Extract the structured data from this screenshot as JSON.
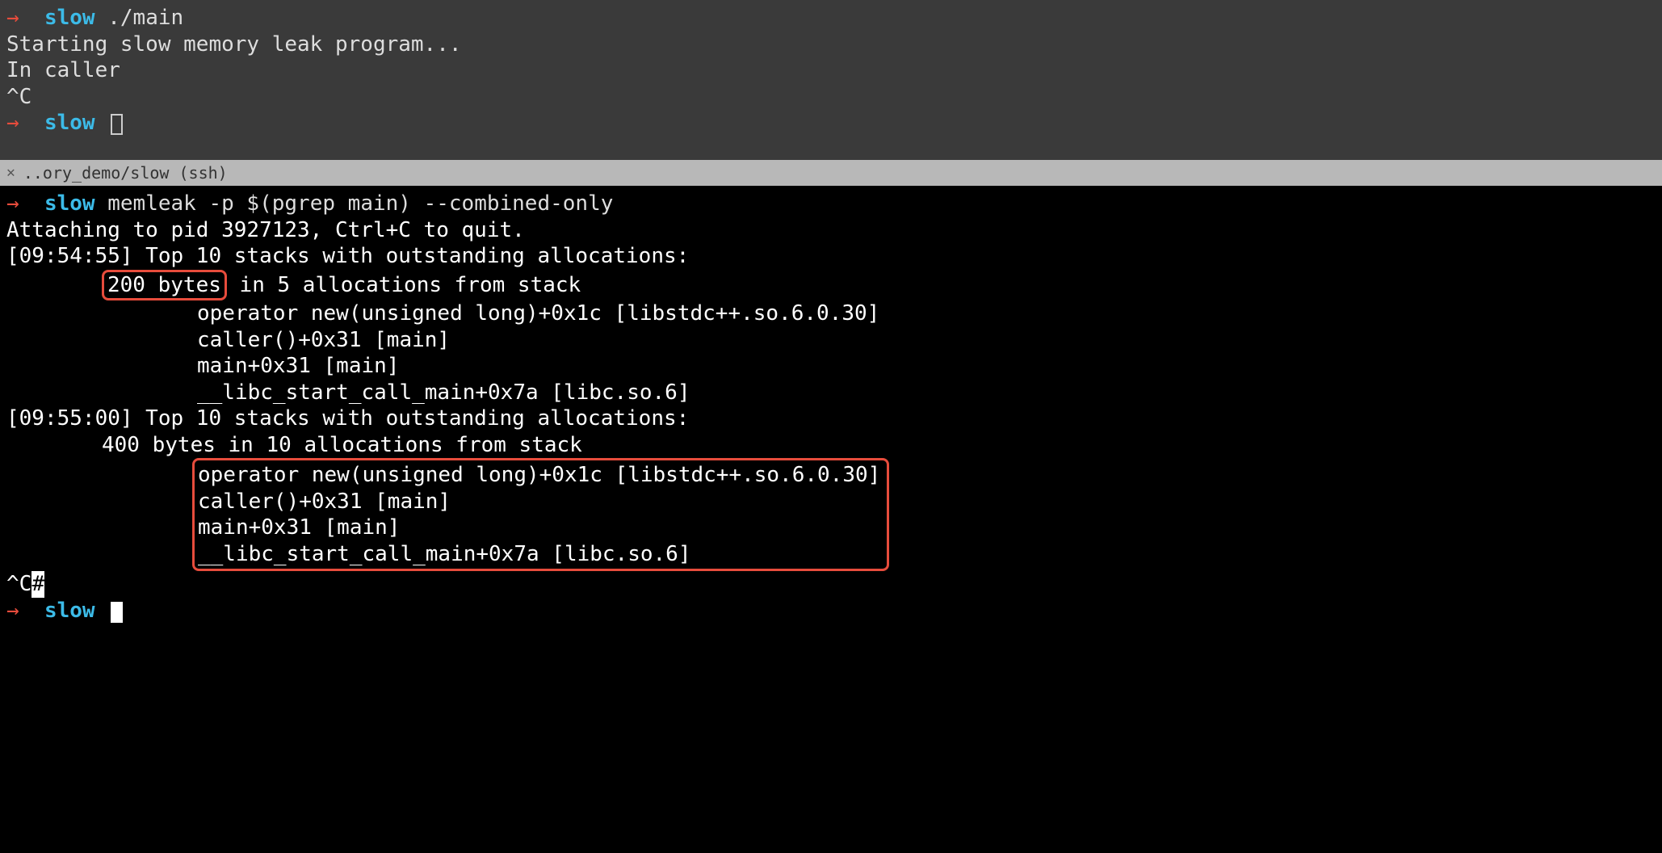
{
  "top": {
    "prompt1_arrow": "→",
    "prompt1_ctx": "slow",
    "prompt1_cmd": "./main",
    "out1": "Starting slow memory leak program...",
    "out2": "In caller",
    "out3": "^C",
    "prompt2_arrow": "→",
    "prompt2_ctx": "slow"
  },
  "tab": {
    "close": "✕",
    "title": "..ory_demo/slow (ssh)"
  },
  "bottom": {
    "prompt1_arrow": "→",
    "prompt1_ctx": "slow",
    "prompt1_cmd": "memleak -p $(pgrep main) --combined-only",
    "line1": "Attaching to pid 3927123, Ctrl+C to quit.",
    "line2": "[09:54:55] Top 10 stacks with outstanding allocations:",
    "hl1": "200 bytes",
    "line3_rest": " in 5 allocations from stack",
    "stack1_1": "operator new(unsigned long)+0x1c [libstdc++.so.6.0.30]",
    "stack1_2": "caller()+0x31 [main]",
    "stack1_3": "main+0x31 [main]",
    "stack1_4": "__libc_start_call_main+0x7a [libc.so.6]",
    "line4": "[09:55:00] Top 10 stacks with outstanding allocations:",
    "line5": "400 bytes in 10 allocations from stack",
    "stack2_1": "operator new(unsigned long)+0x1c [libstdc++.so.6.0.30]",
    "stack2_2": "caller()+0x31 [main]",
    "stack2_3": "main+0x31 [main]",
    "stack2_4": "__libc_start_call_main+0x7a [libc.so.6]",
    "interrupt": "^C",
    "hash": "#",
    "prompt2_arrow": "→",
    "prompt2_ctx": "slow"
  }
}
